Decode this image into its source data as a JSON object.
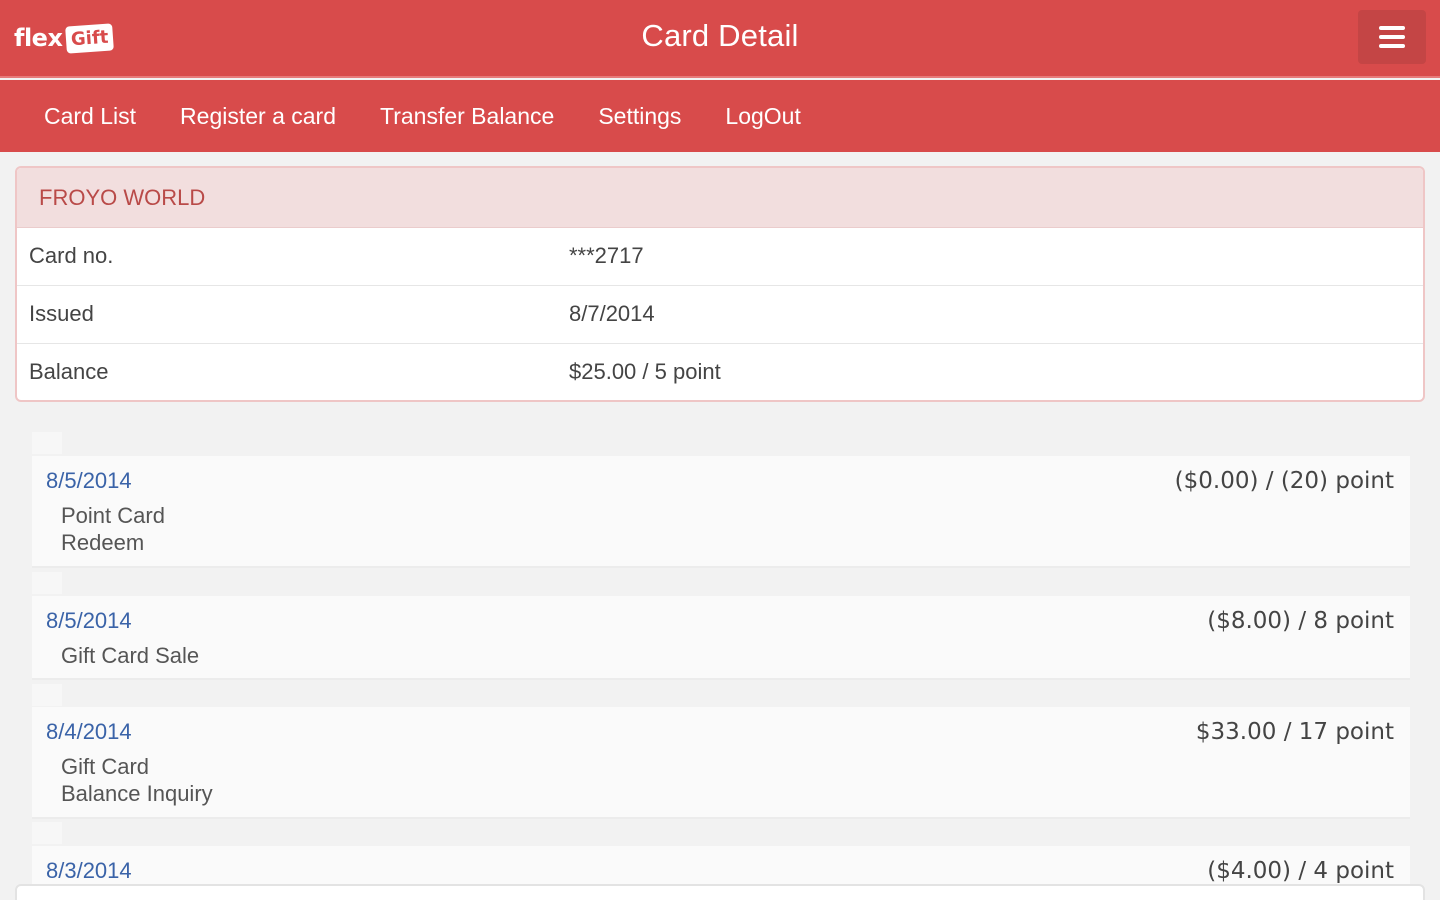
{
  "header": {
    "logo_flex": "flex",
    "logo_gift": "Gift",
    "title": "Card Detail"
  },
  "nav": {
    "items": [
      {
        "label": "Card List"
      },
      {
        "label": "Register a card"
      },
      {
        "label": "Transfer Balance"
      },
      {
        "label": "Settings"
      },
      {
        "label": "LogOut"
      }
    ]
  },
  "card": {
    "merchant": "FROYO WORLD",
    "rows": [
      {
        "label": "Card no.",
        "value": "***2717"
      },
      {
        "label": "Issued",
        "value": "8/7/2014"
      },
      {
        "label": "Balance",
        "value": "$25.00 / 5 point"
      }
    ]
  },
  "transactions": [
    {
      "date": "8/5/2014",
      "amount": "($0.00) / (20) point",
      "desc1": "Point Card",
      "desc2": "Redeem"
    },
    {
      "date": "8/5/2014",
      "amount": "($8.00) / 8 point",
      "desc1": "Gift Card Sale",
      "desc2": ""
    },
    {
      "date": "8/4/2014",
      "amount": "$33.00 / 17 point",
      "desc1": "Gift Card",
      "desc2": "Balance Inquiry"
    },
    {
      "date": "8/3/2014",
      "amount": "($4.00) / 4 point",
      "desc1": "",
      "desc2": ""
    }
  ],
  "colors": {
    "brand": "#d84b4b",
    "panel_header_bg": "#f2dede",
    "panel_header_text": "#b94a48",
    "link": "#3a63a8"
  },
  "icons": {
    "menu": "hamburger-icon"
  }
}
